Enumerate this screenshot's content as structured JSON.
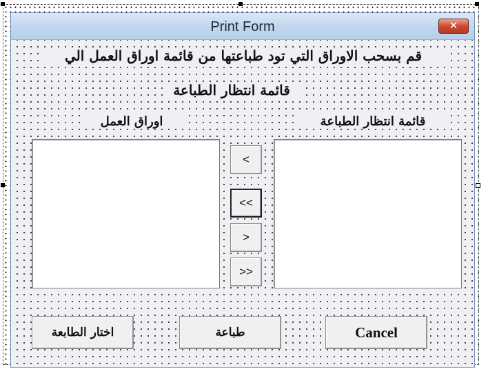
{
  "window": {
    "title": "Print Form",
    "close_icon": "close-icon",
    "close_glyph": "✕"
  },
  "instruction": {
    "line1": "قم بسحب الاوراق التي تود طباعتها من قائمة اوراق العمل الي",
    "line2": "قائمة انتظار الطباعة"
  },
  "lists": {
    "print_queue_label": "قائمة انتظار الطباعة",
    "worksheets_label": "اوراق العمل"
  },
  "move_buttons": [
    {
      "label": "<",
      "name": "move-one-left-button"
    },
    {
      "label": "<<",
      "name": "move-all-left-button"
    },
    {
      "label": ">",
      "name": "move-one-right-button"
    },
    {
      "label": ">>",
      "name": "move-all-right-button"
    }
  ],
  "buttons": {
    "cancel": "Cancel",
    "print": "طباعة",
    "choose_printer": "اختار الطابعة"
  },
  "colors": {
    "titlebar": "#c1d6ee",
    "close_button": "#cd4a32",
    "form_background": "#eef0f3"
  }
}
